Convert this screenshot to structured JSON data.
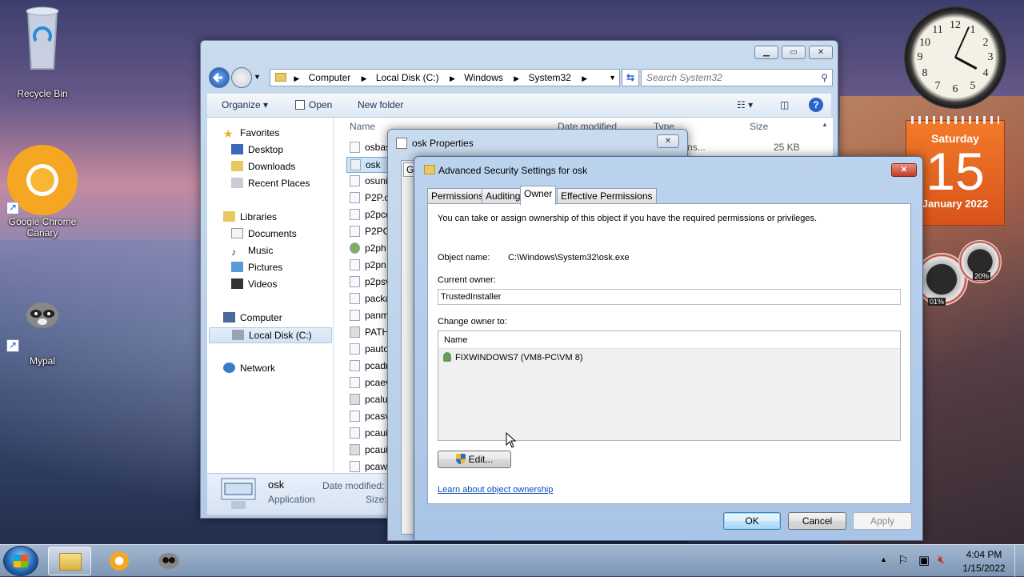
{
  "desktop": {
    "icons": [
      {
        "label": "Recycle Bin"
      },
      {
        "label": "Google Chrome Canary"
      },
      {
        "label": "Mypal"
      }
    ]
  },
  "gadgets": {
    "clock": {
      "numbers": [
        "12",
        "1",
        "2",
        "3",
        "4",
        "5",
        "6",
        "7",
        "8",
        "9",
        "10",
        "11"
      ],
      "time": "4:04"
    },
    "calendar": {
      "weekday": "Saturday",
      "day": "15",
      "month_year": "January 2022"
    },
    "meter": {
      "cpu": "01%",
      "memory": "20%"
    }
  },
  "explorer": {
    "breadcrumb": [
      "Computer",
      "Local Disk (C:)",
      "Windows",
      "System32"
    ],
    "search_placeholder": "Search System32",
    "toolbar": {
      "organize": "Organize",
      "open": "Open",
      "new_folder": "New folder"
    },
    "nav": {
      "favorites": "Favorites",
      "favorites_items": [
        "Desktop",
        "Downloads",
        "Recent Places"
      ],
      "libraries": "Libraries",
      "libraries_items": [
        "Documents",
        "Music",
        "Pictures",
        "Videos"
      ],
      "computer": "Computer",
      "computer_items": [
        "Local Disk (C:)"
      ],
      "network": "Network"
    },
    "columns": {
      "name": "Name",
      "date_modified": "Date modified",
      "type": "Type",
      "size": "Size"
    },
    "files": [
      "osbas",
      "osk",
      "osuni",
      "P2P.c",
      "p2pco",
      "P2PG",
      "p2ph",
      "p2pn",
      "p2psv",
      "packa",
      "panm",
      "PATH",
      "pauto",
      "pcadr",
      "pcaev",
      "pcalu",
      "pcasv",
      "pcaui",
      "pcaui",
      "pcawr"
    ],
    "first_row_type": "ion extens...",
    "first_row_size": "25 KB",
    "details": {
      "name": "osk",
      "type": "Application",
      "date_label": "Date modified:",
      "size_label": "Size:"
    }
  },
  "osk_properties": {
    "title": "osk Properties",
    "partial_tab": "Ge"
  },
  "advanced_security": {
    "title": "Advanced Security Settings for osk",
    "tabs": [
      "Permissions",
      "Auditing",
      "Owner",
      "Effective Permissions"
    ],
    "active_tab": "Owner",
    "intro": "You can take or assign ownership of this object if you have the required permissions or privileges.",
    "object_name_label": "Object name:",
    "object_name": "C:\\Windows\\System32\\osk.exe",
    "current_owner_label": "Current owner:",
    "current_owner": "TrustedInstaller",
    "change_owner_label": "Change owner to:",
    "list_header": "Name",
    "owners": [
      "FIXWINDOWS7 (VM8-PC\\VM 8)"
    ],
    "edit_button": "Edit...",
    "learn_link": "Learn about object ownership",
    "ok": "OK",
    "cancel": "Cancel",
    "apply": "Apply"
  },
  "taskbar": {
    "time": "4:04 PM",
    "date": "1/15/2022"
  }
}
